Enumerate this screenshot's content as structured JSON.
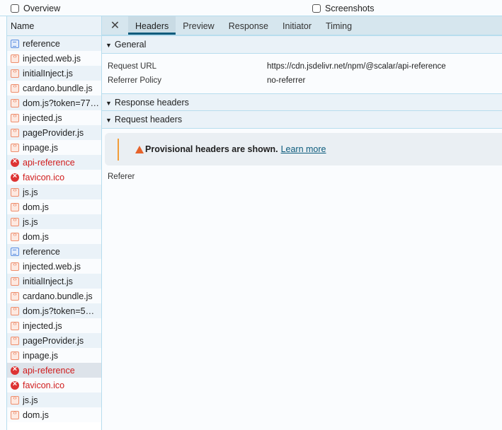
{
  "toolbar": {
    "overview": "Overview",
    "screenshots": "Screenshots"
  },
  "list": {
    "header": "Name",
    "items": [
      {
        "name": "reference",
        "type": "doc"
      },
      {
        "name": "injected.web.js",
        "type": "js"
      },
      {
        "name": "initialInject.js",
        "type": "js"
      },
      {
        "name": "cardano.bundle.js",
        "type": "js"
      },
      {
        "name": "dom.js?token=77…",
        "type": "js"
      },
      {
        "name": "injected.js",
        "type": "js"
      },
      {
        "name": "pageProvider.js",
        "type": "js"
      },
      {
        "name": "inpage.js",
        "type": "js"
      },
      {
        "name": "api-reference",
        "type": "err"
      },
      {
        "name": "favicon.ico",
        "type": "err"
      },
      {
        "name": "js.js",
        "type": "js"
      },
      {
        "name": "dom.js",
        "type": "js"
      },
      {
        "name": "js.js",
        "type": "js"
      },
      {
        "name": "dom.js",
        "type": "js"
      },
      {
        "name": "reference",
        "type": "doc"
      },
      {
        "name": "injected.web.js",
        "type": "js"
      },
      {
        "name": "initialInject.js",
        "type": "js"
      },
      {
        "name": "cardano.bundle.js",
        "type": "js"
      },
      {
        "name": "dom.js?token=5…",
        "type": "js"
      },
      {
        "name": "injected.js",
        "type": "js"
      },
      {
        "name": "pageProvider.js",
        "type": "js"
      },
      {
        "name": "inpage.js",
        "type": "js"
      },
      {
        "name": "api-reference",
        "type": "err",
        "selected": true
      },
      {
        "name": "favicon.ico",
        "type": "err"
      },
      {
        "name": "js.js",
        "type": "js"
      },
      {
        "name": "dom.js",
        "type": "js"
      }
    ]
  },
  "tabs": [
    "Headers",
    "Preview",
    "Response",
    "Initiator",
    "Timing"
  ],
  "general": {
    "title": "General",
    "rows": [
      {
        "k": "Request URL",
        "v": "https://cdn.jsdelivr.net/npm/@scalar/api-reference"
      },
      {
        "k": "Referrer Policy",
        "v": "no-referrer"
      }
    ]
  },
  "response_headers": {
    "title": "Response headers"
  },
  "request_headers": {
    "title": "Request headers",
    "warning": "Provisional headers are shown.",
    "link": "Learn more",
    "referer": "Referer"
  }
}
